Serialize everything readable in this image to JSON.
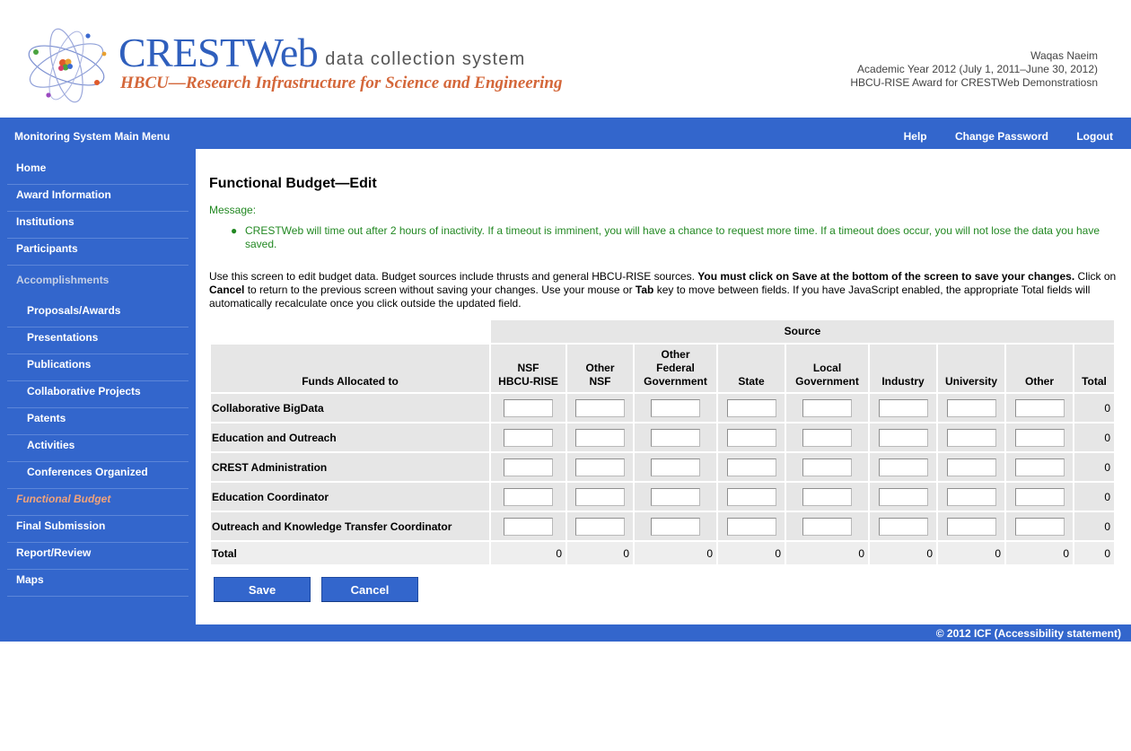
{
  "header": {
    "brand_name": "CRESTWeb",
    "brand_sub": "data collection system",
    "brand_tagline": "HBCU—Research Infrastructure for Science and Engineering",
    "user_name": "Waqas Naeim",
    "academic_year": "Academic Year 2012 (July 1, 2011–June 30, 2012)",
    "award": "HBCU-RISE Award for CRESTWeb Demonstratiosn"
  },
  "topbar": {
    "main_menu": "Monitoring System Main Menu",
    "help": "Help",
    "change_password": "Change Password",
    "logout": "Logout"
  },
  "sidebar": {
    "items": [
      {
        "label": "Home"
      },
      {
        "label": "Award Information"
      },
      {
        "label": "Institutions"
      },
      {
        "label": "Participants"
      },
      {
        "label": "Accomplishments"
      },
      {
        "label": "Proposals/Awards"
      },
      {
        "label": "Presentations"
      },
      {
        "label": "Publications"
      },
      {
        "label": "Collaborative Projects"
      },
      {
        "label": "Patents"
      },
      {
        "label": "Activities"
      },
      {
        "label": "Conferences Organized"
      },
      {
        "label": "Functional Budget"
      },
      {
        "label": "Final Submission"
      },
      {
        "label": "Report/Review"
      },
      {
        "label": "Maps"
      }
    ]
  },
  "main": {
    "title": "Functional Budget—Edit",
    "message_label": "Message:",
    "messages": [
      "CRESTWeb will time out after 2 hours of inactivity. If a timeout is imminent, you will have a chance to request more time. If a timeout does occur, you will not lose the data you have saved."
    ],
    "instructions": {
      "part1": "Use this screen to edit budget data. Budget sources include thrusts and general HBCU-RISE sources. ",
      "bold1": "You must click on Save at the bottom of the screen to save your changes.",
      "part2": " Click on ",
      "bold2": "Cancel",
      "part3": " to return to the previous screen without saving your changes. Use your mouse or ",
      "bold3": "Tab",
      "part4": " key to move between fields. If you have JavaScript enabled, the appropriate Total fields will automatically recalculate once you click outside the updated field."
    }
  },
  "table": {
    "source_header": "Source",
    "row_header": "Funds Allocated to",
    "columns": [
      [
        "NSF",
        "HBCU-RISE"
      ],
      [
        "Other",
        "NSF"
      ],
      [
        "Other",
        "Federal",
        "Government"
      ],
      [
        "State"
      ],
      [
        "Local",
        "Government"
      ],
      [
        "Industry"
      ],
      [
        "University"
      ],
      [
        "Other"
      ],
      [
        "Total"
      ]
    ],
    "rows": [
      {
        "name": "Collaborative BigData",
        "values": [
          "",
          "",
          "",
          "",
          "",
          "",
          "",
          ""
        ],
        "total": "0"
      },
      {
        "name": "Education and Outreach",
        "values": [
          "",
          "",
          "",
          "",
          "",
          "",
          "",
          ""
        ],
        "total": "0"
      },
      {
        "name": "CREST Administration",
        "values": [
          "",
          "",
          "",
          "",
          "",
          "",
          "",
          ""
        ],
        "total": "0"
      },
      {
        "name": "Education Coordinator",
        "values": [
          "",
          "",
          "",
          "",
          "",
          "",
          "",
          ""
        ],
        "total": "0"
      },
      {
        "name": "Outreach and Knowledge Transfer Coordinator",
        "values": [
          "",
          "",
          "",
          "",
          "",
          "",
          "",
          ""
        ],
        "total": "0"
      }
    ],
    "total_row": {
      "name": "Total",
      "values": [
        "0",
        "0",
        "0",
        "0",
        "0",
        "0",
        "0",
        "0",
        "0"
      ]
    }
  },
  "buttons": {
    "save": "Save",
    "cancel": "Cancel"
  },
  "footer": {
    "text": "© 2012 ICF (Accessibility statement)"
  },
  "colors": {
    "primary_blue": "#3366cc",
    "brand_orange": "#d4673a",
    "message_green": "#228822",
    "active_nav": "#f2a37b"
  }
}
